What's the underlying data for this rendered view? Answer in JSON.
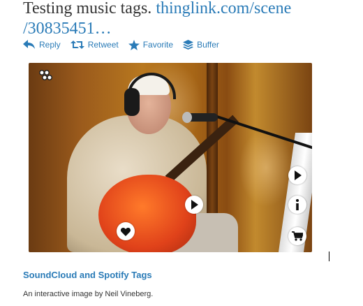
{
  "tweet": {
    "text": "Testing music tags. ",
    "link": "thinglink.com/scene /30835451…"
  },
  "actions": [
    {
      "label": "Reply",
      "icon": "reply-icon"
    },
    {
      "label": "Retweet",
      "icon": "retweet-icon"
    },
    {
      "label": "Favorite",
      "icon": "star-icon"
    },
    {
      "label": "Buffer",
      "icon": "buffer-icon"
    }
  ],
  "media": {
    "overlay_icons": [
      "thinglink-dots-icon",
      "play-icon",
      "play-icon",
      "info-icon",
      "cart-icon",
      "heart-icon"
    ]
  },
  "caption": {
    "title": "SoundCloud and Spotify Tags",
    "subtitle": "An interactive image by Neil Vineberg."
  },
  "colors": {
    "link": "#2a7bb7",
    "text": "#333333"
  }
}
